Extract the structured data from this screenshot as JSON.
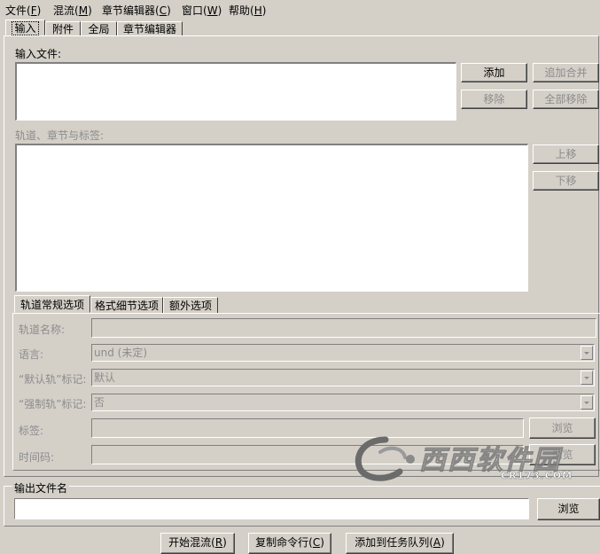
{
  "menu": [
    {
      "label": "文件",
      "key": "F"
    },
    {
      "label": "混流",
      "key": "M"
    },
    {
      "label": "章节编辑器",
      "key": "C"
    },
    {
      "label": "窗口",
      "key": "W"
    },
    {
      "label": "帮助",
      "key": "H"
    }
  ],
  "main_tabs": [
    "输入",
    "附件",
    "全局",
    "章节编辑器"
  ],
  "input_section": {
    "input_files_label": "输入文件:",
    "add": "添加",
    "append": "追加合并",
    "remove": "移除",
    "remove_all": "全部移除",
    "tracks_label": "轨道、章节与标签:",
    "move_up": "上移",
    "move_down": "下移"
  },
  "option_tabs": [
    "轨道常规选项",
    "格式细节选项",
    "额外选项"
  ],
  "track_options": {
    "track_name_label": "轨道名称:",
    "track_name_value": "",
    "language_label": "语言:",
    "language_value": "und (未定)",
    "default_flag_label": "“默认轨”标记:",
    "default_flag_value": "默认",
    "forced_flag_label": "“强制轨”标记:",
    "forced_flag_value": "否",
    "tags_label": "标签:",
    "tags_browse": "浏览",
    "timecodes_label": "时间码:",
    "timecodes_browse": "浏览"
  },
  "output": {
    "label": "输出文件名",
    "value": "",
    "browse": "浏览"
  },
  "bottom_buttons": {
    "start": {
      "label": "开始混流",
      "key": "R"
    },
    "copy_cmd": {
      "label": "复制命令行",
      "key": "C"
    },
    "add_queue": {
      "label": "添加到任务队列",
      "key": "A"
    }
  },
  "watermark": {
    "text": "西西软件园",
    "sub": "CR173.COM"
  }
}
